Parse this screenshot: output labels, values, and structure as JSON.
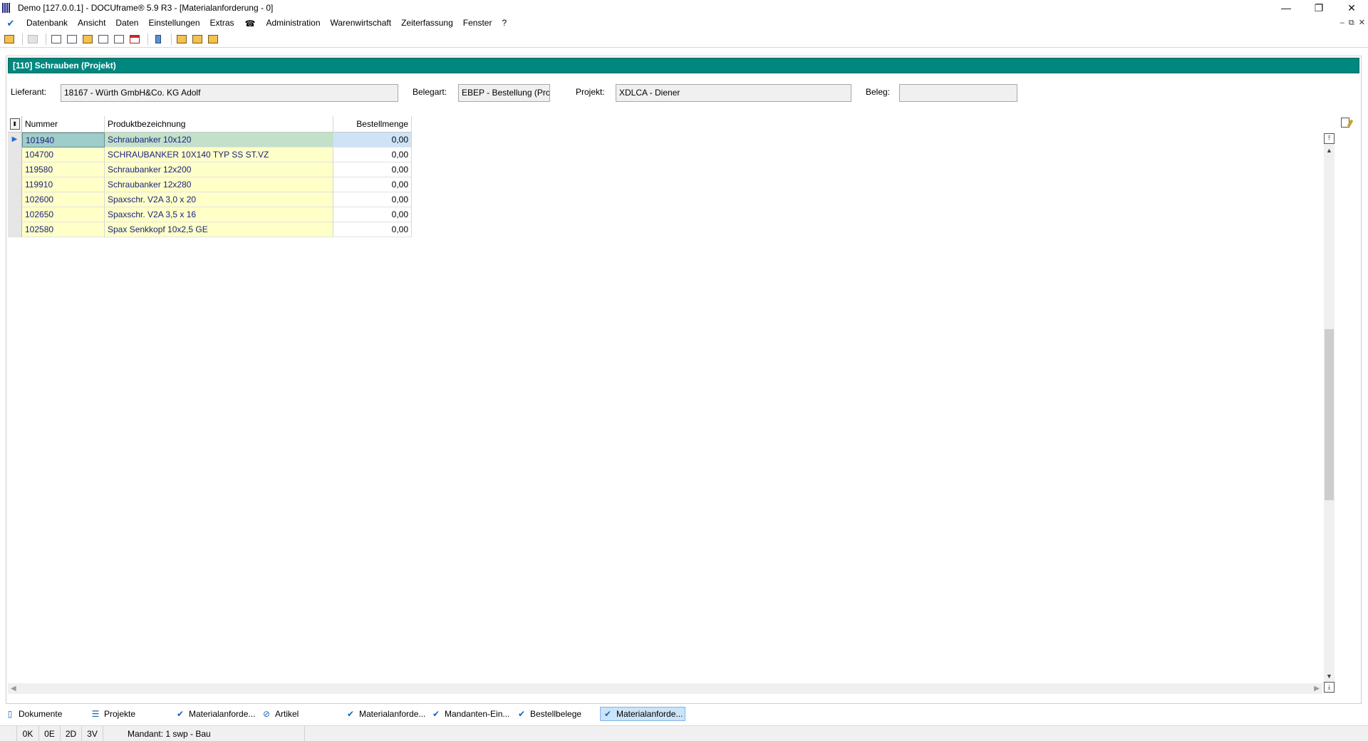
{
  "window": {
    "title": "Demo [127.0.0.1] - DOCUframe® 5.9 R3 - [Materialanforderung - 0]",
    "controls": [
      "—",
      "❐",
      "✕"
    ]
  },
  "menu": {
    "items": [
      "Datenbank",
      "Ansicht",
      "Daten",
      "Einstellungen",
      "Extras",
      "☎",
      "Administration",
      "Warenwirtschaft",
      "Zeiterfassung",
      "Fenster",
      "?"
    ],
    "mdi_controls": [
      "–",
      "⧉",
      "✕"
    ]
  },
  "form": {
    "header": "[110] Schrauben (Projekt)",
    "lieferant_label": "Lieferant:",
    "lieferant_value": "18167 - Würth GmbH&Co. KG Adolf",
    "belegart_label": "Belegart:",
    "belegart_value": "EBEP - Bestellung (Projekt)",
    "projekt_label": "Projekt:",
    "projekt_value": "XDLCA - Diener",
    "beleg_label": "Beleg:",
    "beleg_value": ""
  },
  "grid": {
    "columns": [
      "Nummer",
      "Produktbezeichnung",
      "Bestellmenge"
    ],
    "rows": [
      {
        "nummer": "101940",
        "name": "Schraubanker 10x120",
        "menge": "0,00"
      },
      {
        "nummer": "104700",
        "name": "SCHRAUBANKER 10X140 TYP SS ST.VZ",
        "menge": "0,00"
      },
      {
        "nummer": "119580",
        "name": "Schraubanker 12x200",
        "menge": "0,00"
      },
      {
        "nummer": "119910",
        "name": "Schraubanker 12x280",
        "menge": "0,00"
      },
      {
        "nummer": "102600",
        "name": "Spaxschr. V2A 3,0 x 20",
        "menge": "0,00"
      },
      {
        "nummer": "102650",
        "name": "Spaxschr. V2A 3,5 x 16",
        "menge": "0,00"
      },
      {
        "nummer": "102580",
        "name": "Spax Senkkopf 10x2,5 GE",
        "menge": "0,00"
      }
    ],
    "selected_row": 0
  },
  "tasks": {
    "items": [
      "Dokumente",
      "Projekte",
      "Materialanforde...",
      "Artikel",
      "Materialanforde...",
      "Mandanten-Ein...",
      "Bestellbelege",
      "Materialanforde..."
    ],
    "active": 7
  },
  "status": {
    "k": "0K",
    "e": "0E",
    "d": "2D",
    "v": "3V",
    "mandant": "Mandant: 1 swp - Bau"
  },
  "colors": {
    "header_bg": "#00877e",
    "row_highlight": "#ffffc8",
    "text_blue": "#1a237e"
  }
}
